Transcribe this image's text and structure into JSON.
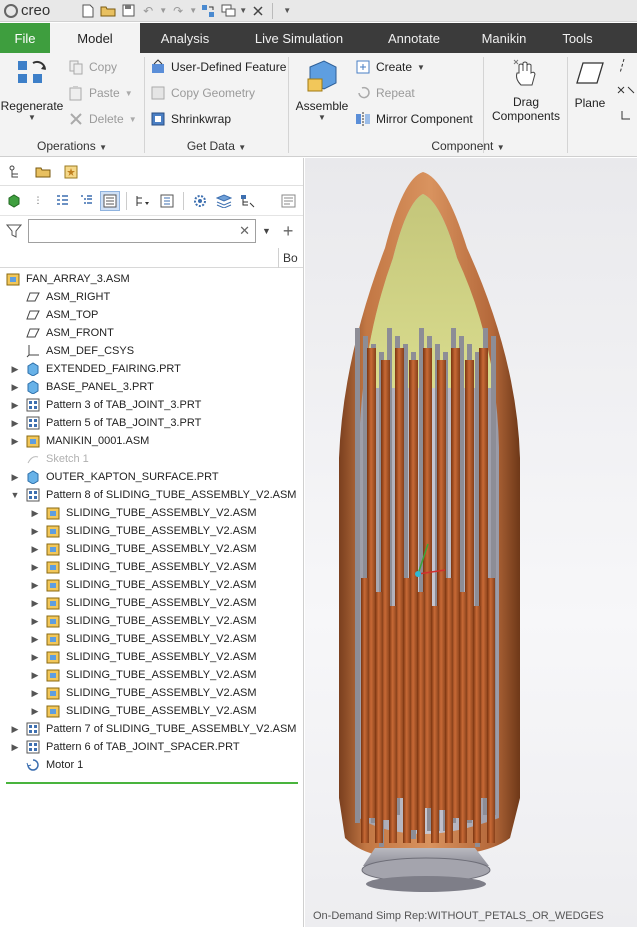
{
  "app": {
    "logo": "creo"
  },
  "tabs": [
    "File",
    "Model",
    "Analysis",
    "Live Simulation",
    "Annotate",
    "Manikin",
    "Tools"
  ],
  "ribbon": {
    "operations": {
      "label": "Operations",
      "regenerate": "Regenerate",
      "copy": "Copy",
      "paste": "Paste",
      "delete": "Delete"
    },
    "get_data": {
      "label": "Get Data",
      "udf": "User-Defined Feature",
      "copy_geometry": "Copy Geometry",
      "shrinkwrap": "Shrinkwrap"
    },
    "component": {
      "label": "Component",
      "assemble": "Assemble",
      "create": "Create",
      "repeat": "Repeat",
      "mirror": "Mirror Component",
      "drag1": "Drag",
      "drag2": "Components"
    },
    "datum": {
      "plane": "Plane"
    }
  },
  "tree": {
    "column2": "Bo",
    "search_placeholder": "",
    "items": [
      {
        "label": "FAN_ARRAY_3.ASM",
        "icon": "assembly-icon",
        "level": 0,
        "expander": ""
      },
      {
        "label": "ASM_RIGHT",
        "icon": "datum-plane-icon",
        "level": 1,
        "expander": ""
      },
      {
        "label": "ASM_TOP",
        "icon": "datum-plane-icon",
        "level": 1,
        "expander": ""
      },
      {
        "label": "ASM_FRONT",
        "icon": "datum-plane-icon",
        "level": 1,
        "expander": ""
      },
      {
        "label": "ASM_DEF_CSYS",
        "icon": "csys-icon",
        "level": 1,
        "expander": ""
      },
      {
        "label": "EXTENDED_FAIRING.PRT",
        "icon": "part-icon",
        "level": 1,
        "expander": "▶"
      },
      {
        "label": "BASE_PANEL_3.PRT",
        "icon": "part-icon",
        "level": 1,
        "expander": "▶"
      },
      {
        "label": "Pattern 3 of TAB_JOINT_3.PRT",
        "icon": "pattern-icon",
        "level": 1,
        "expander": "▶"
      },
      {
        "label": "Pattern 5 of TAB_JOINT_3.PRT",
        "icon": "pattern-icon",
        "level": 1,
        "expander": "▶"
      },
      {
        "label": "MANIKIN_0001.ASM",
        "icon": "assembly-icon",
        "level": 1,
        "expander": "▶"
      },
      {
        "label": "Sketch 1",
        "icon": "sketch-icon",
        "level": 1,
        "expander": "",
        "muted": true
      },
      {
        "label": "OUTER_KAPTON_SURFACE.PRT",
        "icon": "part-icon",
        "level": 1,
        "expander": "▶"
      },
      {
        "label": "Pattern 8 of SLIDING_TUBE_ASSEMBLY_V2.ASM",
        "icon": "pattern-icon",
        "level": 1,
        "expander": "▼"
      },
      {
        "label": "SLIDING_TUBE_ASSEMBLY_V2.ASM",
        "icon": "assembly-icon",
        "level": 2,
        "expander": "▶"
      },
      {
        "label": "SLIDING_TUBE_ASSEMBLY_V2.ASM",
        "icon": "assembly-icon",
        "level": 2,
        "expander": "▶"
      },
      {
        "label": "SLIDING_TUBE_ASSEMBLY_V2.ASM",
        "icon": "assembly-icon",
        "level": 2,
        "expander": "▶"
      },
      {
        "label": "SLIDING_TUBE_ASSEMBLY_V2.ASM",
        "icon": "assembly-icon",
        "level": 2,
        "expander": "▶"
      },
      {
        "label": "SLIDING_TUBE_ASSEMBLY_V2.ASM",
        "icon": "assembly-icon",
        "level": 2,
        "expander": "▶"
      },
      {
        "label": "SLIDING_TUBE_ASSEMBLY_V2.ASM",
        "icon": "assembly-icon",
        "level": 2,
        "expander": "▶"
      },
      {
        "label": "SLIDING_TUBE_ASSEMBLY_V2.ASM",
        "icon": "assembly-icon",
        "level": 2,
        "expander": "▶"
      },
      {
        "label": "SLIDING_TUBE_ASSEMBLY_V2.ASM",
        "icon": "assembly-icon",
        "level": 2,
        "expander": "▶"
      },
      {
        "label": "SLIDING_TUBE_ASSEMBLY_V2.ASM",
        "icon": "assembly-icon",
        "level": 2,
        "expander": "▶"
      },
      {
        "label": "SLIDING_TUBE_ASSEMBLY_V2.ASM",
        "icon": "assembly-icon",
        "level": 2,
        "expander": "▶"
      },
      {
        "label": "SLIDING_TUBE_ASSEMBLY_V2.ASM",
        "icon": "assembly-icon",
        "level": 2,
        "expander": "▶"
      },
      {
        "label": "SLIDING_TUBE_ASSEMBLY_V2.ASM",
        "icon": "assembly-icon",
        "level": 2,
        "expander": "▶"
      },
      {
        "label": "Pattern 7 of SLIDING_TUBE_ASSEMBLY_V2.ASM",
        "icon": "pattern-icon",
        "level": 1,
        "expander": "▶"
      },
      {
        "label": "Pattern 6 of TAB_JOINT_SPACER.PRT",
        "icon": "pattern-icon",
        "level": 1,
        "expander": "▶"
      },
      {
        "label": "Motor 1",
        "icon": "motor-icon",
        "level": 1,
        "expander": ""
      }
    ]
  },
  "status": {
    "simp_rep": "On-Demand Simp Rep:WITHOUT_PETALS_OR_WEDGES"
  },
  "colors": {
    "file_tab": "#3e9e3e",
    "tab_bar": "#3b3b3b",
    "fairing": "#b4683a",
    "tube": "#b0562a",
    "insert_line": "#49b43d"
  }
}
